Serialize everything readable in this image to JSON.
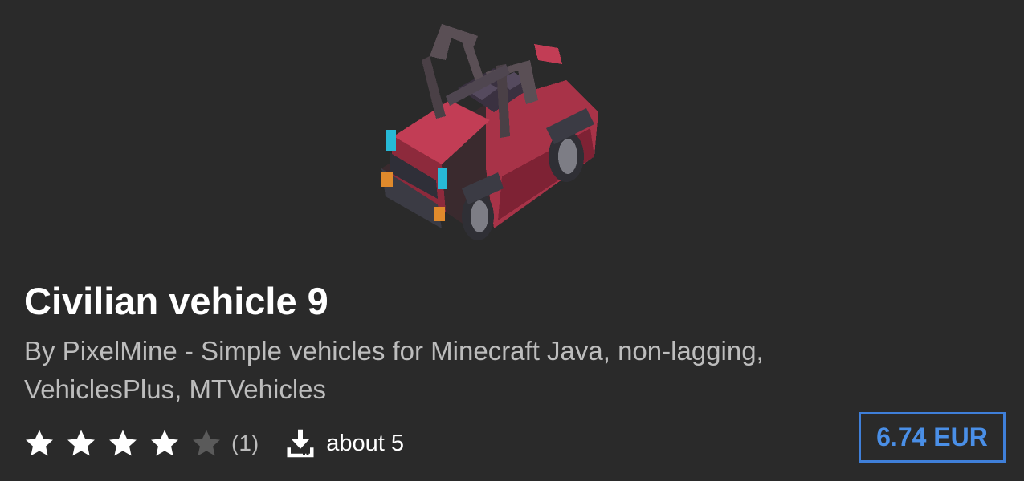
{
  "product": {
    "title": "Civilian vehicle 9",
    "description": "By PixelMine - Simple vehicles for Minecraft Java, non-lagging, VehiclesPlus, MTVehicles",
    "image_icon": "pixel-art-red-jeep",
    "rating": {
      "stars_filled": 4,
      "stars_total": 5,
      "review_count": "(1)"
    },
    "downloads": {
      "icon": "download-icon",
      "label": "about 5"
    },
    "price": "6.74 EUR"
  },
  "colors": {
    "background": "#2a2a2a",
    "title": "#ffffff",
    "description": "#bdbdbd",
    "star_filled": "#ffffff",
    "star_empty": "#5a5a5a",
    "price_accent": "#3f7fd9"
  }
}
